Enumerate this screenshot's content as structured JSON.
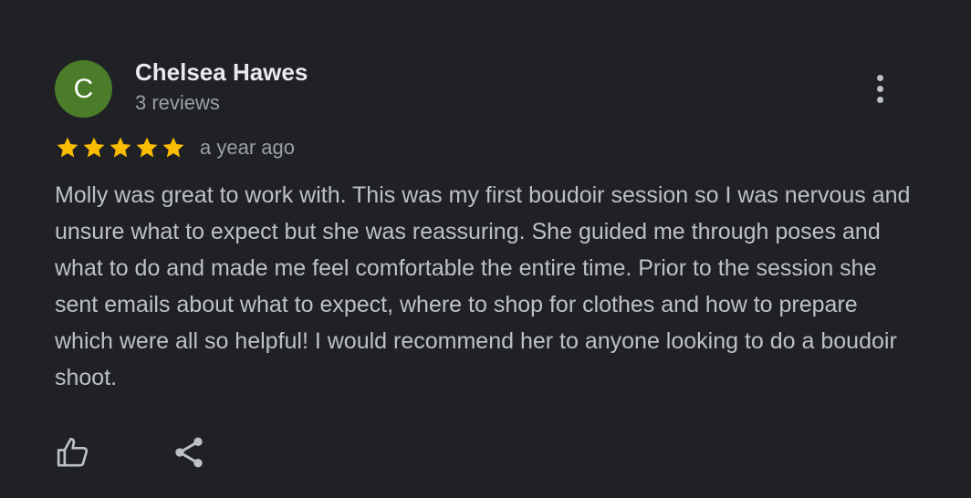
{
  "reviewer": {
    "initial": "C",
    "name": "Chelsea Hawes",
    "review_count": "3 reviews",
    "avatar_color": "#4a7c2a"
  },
  "rating": {
    "stars": 5,
    "max_stars": 5,
    "star_color": "#fbbc04",
    "date": "a year ago"
  },
  "review": {
    "text": "Molly was great to work with. This was my first boudoir session so I was nervous and unsure what to expect but she was reassuring. She guided me through poses and what to do and made me feel comfortable the entire time. Prior to the session she sent emails about what to expect, where to shop for clothes and how to prepare which were all so helpful! I would recommend her to anyone looking to do a boudoir shoot."
  },
  "actions": {
    "more_icon": "more-vert-icon",
    "like_icon": "thumbs-up-icon",
    "share_icon": "share-icon"
  },
  "theme": {
    "background": "#202124",
    "text_primary": "#e8eaed",
    "text_secondary": "#9aa0a6"
  }
}
